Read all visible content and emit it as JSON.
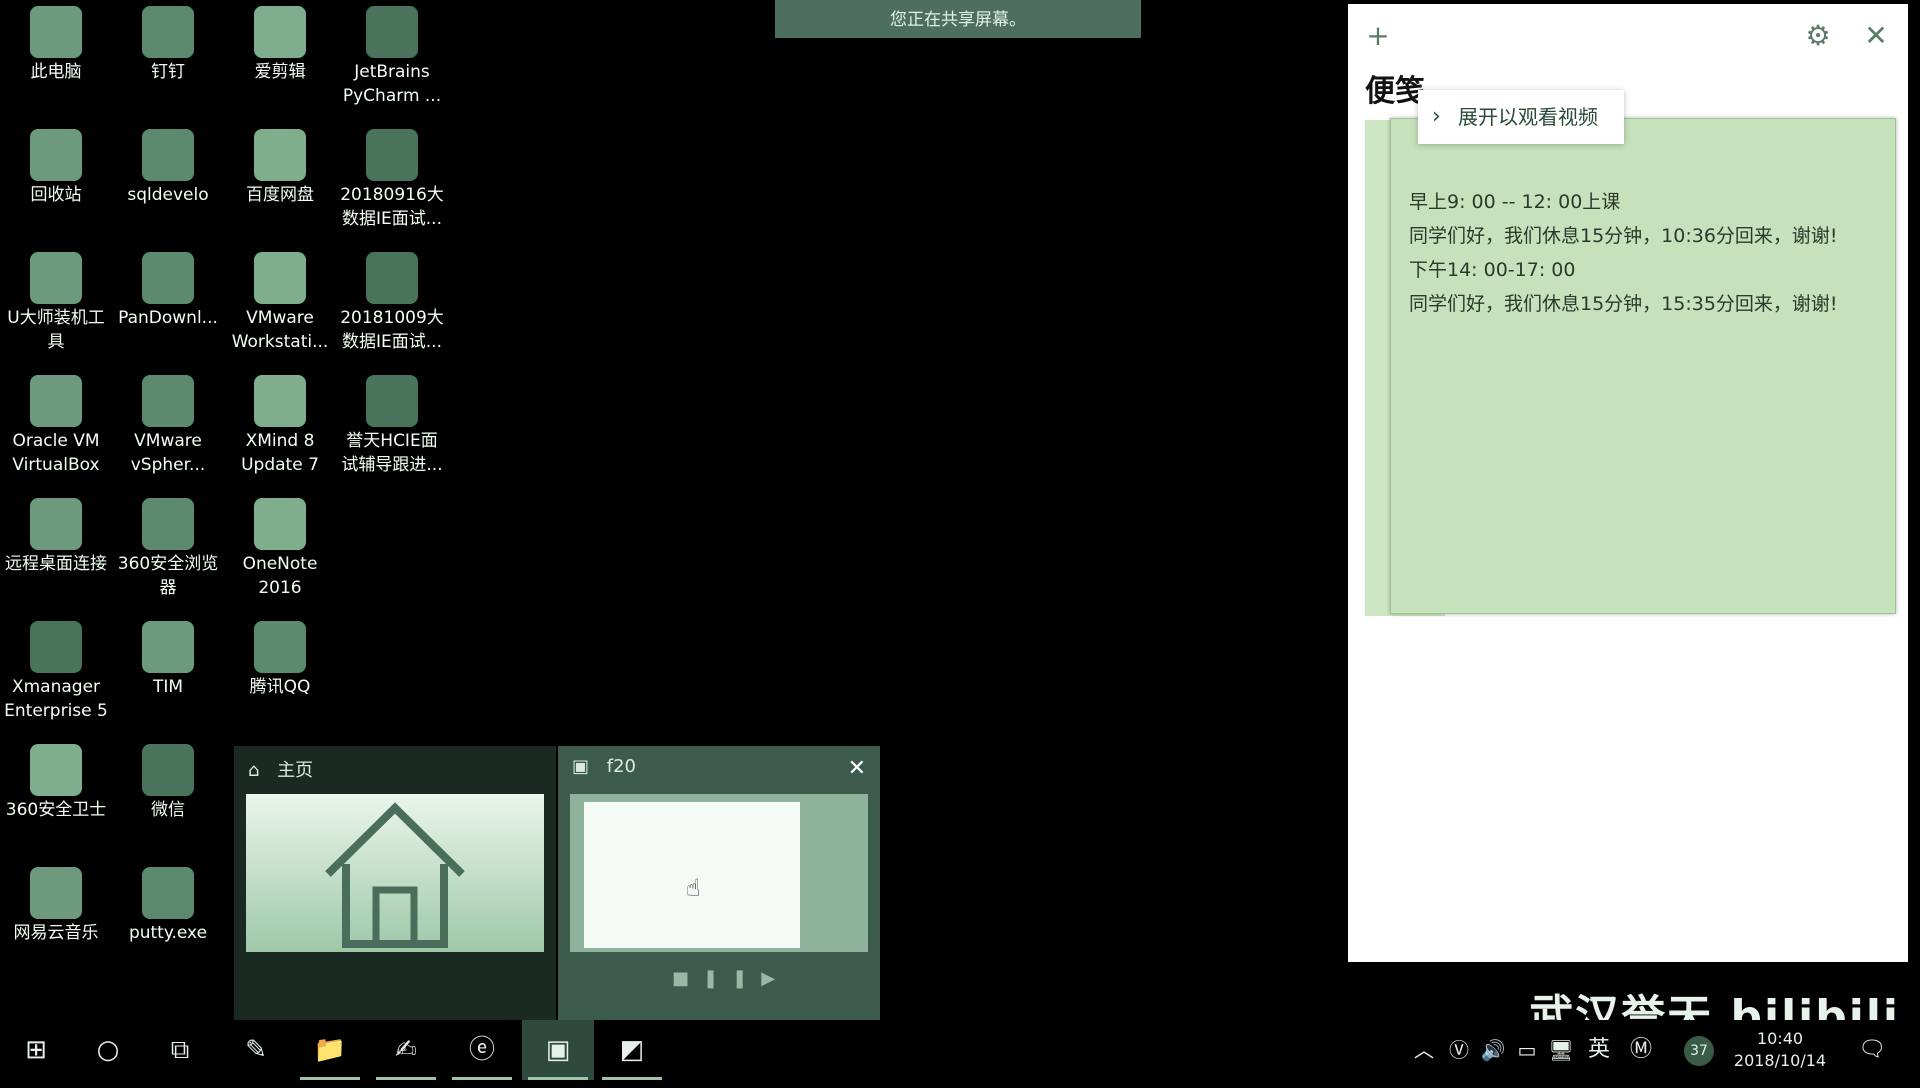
{
  "share_banner": "您正在共享屏幕。",
  "desktop_icons": [
    {
      "label": "此电脑",
      "icon": "computer-icon"
    },
    {
      "label": "钉钉",
      "icon": "dingtalk-icon"
    },
    {
      "label": "爱剪辑",
      "icon": "ijianji-icon"
    },
    {
      "label": "JetBrains PyCharm ...",
      "icon": "pycharm-icon"
    },
    {
      "label": "回收站",
      "icon": "recycle-bin-icon"
    },
    {
      "label": "sqldevelo",
      "icon": "sqldeveloper-icon"
    },
    {
      "label": "百度网盘",
      "icon": "baidu-netdisk-icon"
    },
    {
      "label": "20180916大数据IE面试...",
      "icon": "word-doc-icon"
    },
    {
      "label": "U大师装机工具",
      "icon": "udashi-icon"
    },
    {
      "label": "PanDownl...",
      "icon": "pandownload-icon"
    },
    {
      "label": "VMware Workstati...",
      "icon": "vmware-icon"
    },
    {
      "label": "20181009大数据IE面试...",
      "icon": "word-doc-icon"
    },
    {
      "label": "Oracle VM VirtualBox",
      "icon": "virtualbox-icon"
    },
    {
      "label": "VMware vSpher...",
      "icon": "vsphere-icon"
    },
    {
      "label": "XMind 8 Update 7",
      "icon": "xmind-icon"
    },
    {
      "label": "誉天HCIE面试辅导跟进...",
      "icon": "excel-doc-icon"
    },
    {
      "label": "远程桌面连接",
      "icon": "remote-desktop-icon"
    },
    {
      "label": "360安全浏览器",
      "icon": "360-browser-icon"
    },
    {
      "label": "OneNote 2016",
      "icon": "onenote-icon"
    },
    {
      "label": "Xmanager Enterprise 5",
      "icon": "xmanager-icon"
    },
    {
      "label": "TIM",
      "icon": "tim-icon"
    },
    {
      "label": "腾讯QQ",
      "icon": "qq-icon"
    },
    {
      "label": "360安全卫士",
      "icon": "360-security-icon"
    },
    {
      "label": "微信",
      "icon": "wechat-icon"
    },
    {
      "label": "网易云音乐",
      "icon": "netease-music-icon"
    },
    {
      "label": "putty.exe",
      "icon": "putty-icon"
    }
  ],
  "sticky_notes": {
    "title": "便笺",
    "tip": "展开以观看视频",
    "lines": [
      "早上9: 00 -- 12: 00上课",
      "同学们好，我们休息15分钟，10:36分回来，谢谢!",
      "下午14: 00-17: 00",
      "同学们好，我们休息15分钟，15:35分回来，谢谢!"
    ]
  },
  "thumbnails": {
    "home_title": "主页",
    "f20_title": "f20"
  },
  "tray": {
    "ime": "英",
    "badge": "37",
    "date": "2018/10/14",
    "time": "10:40"
  },
  "watermark": "武汉誉天 bilibili",
  "accent_color": "#9cc4a6"
}
